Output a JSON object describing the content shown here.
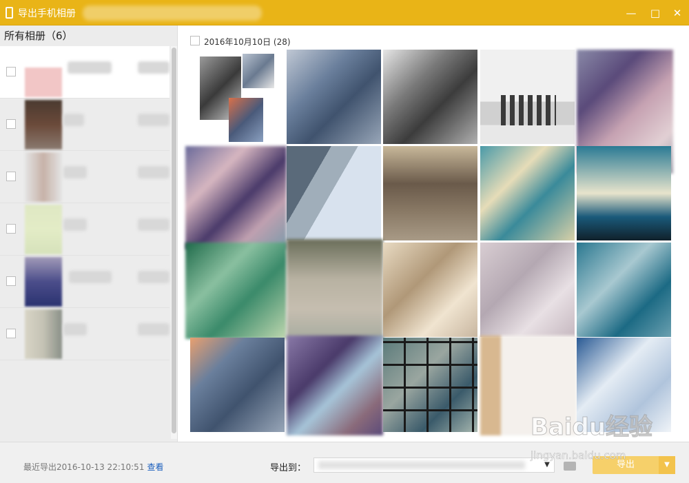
{
  "window": {
    "title": "导出手机相册",
    "controls": [
      "minimize-icon",
      "maximize-icon",
      "close-icon"
    ]
  },
  "sidebar": {
    "title": "所有相册（6）",
    "albums": [
      {
        "thumb_color": "#f2c6c6",
        "checked": false
      },
      {
        "thumb_color": "#6b4a3a",
        "checked": false
      },
      {
        "thumb_color": "#c7b2a8",
        "checked": false
      },
      {
        "thumb_color": "#e3ecc6",
        "checked": false
      },
      {
        "thumb_color": "#4b4d8a",
        "checked": false
      },
      {
        "thumb_color": "#c4c2b4",
        "checked": false
      }
    ]
  },
  "main": {
    "date_group_label": "2016年10月10日 (28)"
  },
  "footer": {
    "last_export_label": "最近导出2016-10-13 22:10:51",
    "view_link": "查看",
    "export_to_label": "导出到：",
    "export_button": "导出"
  },
  "watermark": {
    "brand": "Baidu经验",
    "url": "jingyan.baidu.com"
  },
  "colors": {
    "accent": "#e9b417",
    "link": "#1a5ebd",
    "export_button": "#f6d06a"
  }
}
